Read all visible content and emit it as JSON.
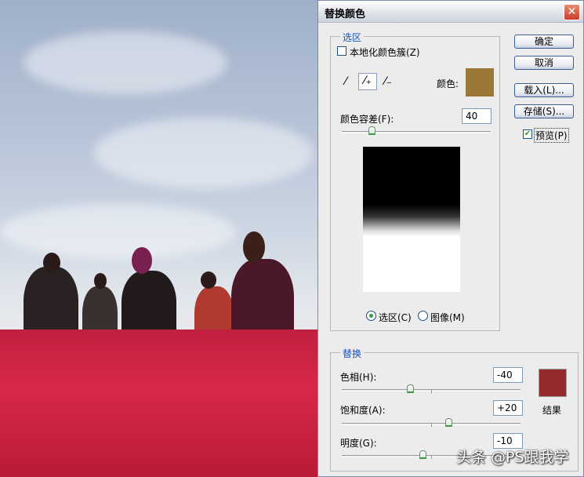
{
  "dialog": {
    "title": "替换颜色",
    "close": "✕"
  },
  "selection": {
    "legend": "选区",
    "localized_label": "本地化颜色簇(Z)",
    "localized_checked": false,
    "color_label": "颜色:",
    "swatch_color": "#9c7838",
    "fuzziness_label": "颜色容差(F):",
    "fuzziness": "40",
    "fuzziness_pct": 0.2,
    "view_selection": "选区(C)",
    "view_image": "图像(M)",
    "view_selected": "selection"
  },
  "buttons": {
    "ok": "确定",
    "cancel": "取消",
    "load": "载入(L)...",
    "save": "存储(S)...",
    "preview": "预览(P)",
    "preview_checked": true
  },
  "replacement": {
    "legend": "替换",
    "hue_label": "色相(H):",
    "hue": "-40",
    "sat_label": "饱和度(A):",
    "sat": "+20",
    "light_label": "明度(G):",
    "light": "-10",
    "result_label": "结果",
    "result_color": "#962a2e"
  },
  "watermark": "头条 @PS跟我学"
}
